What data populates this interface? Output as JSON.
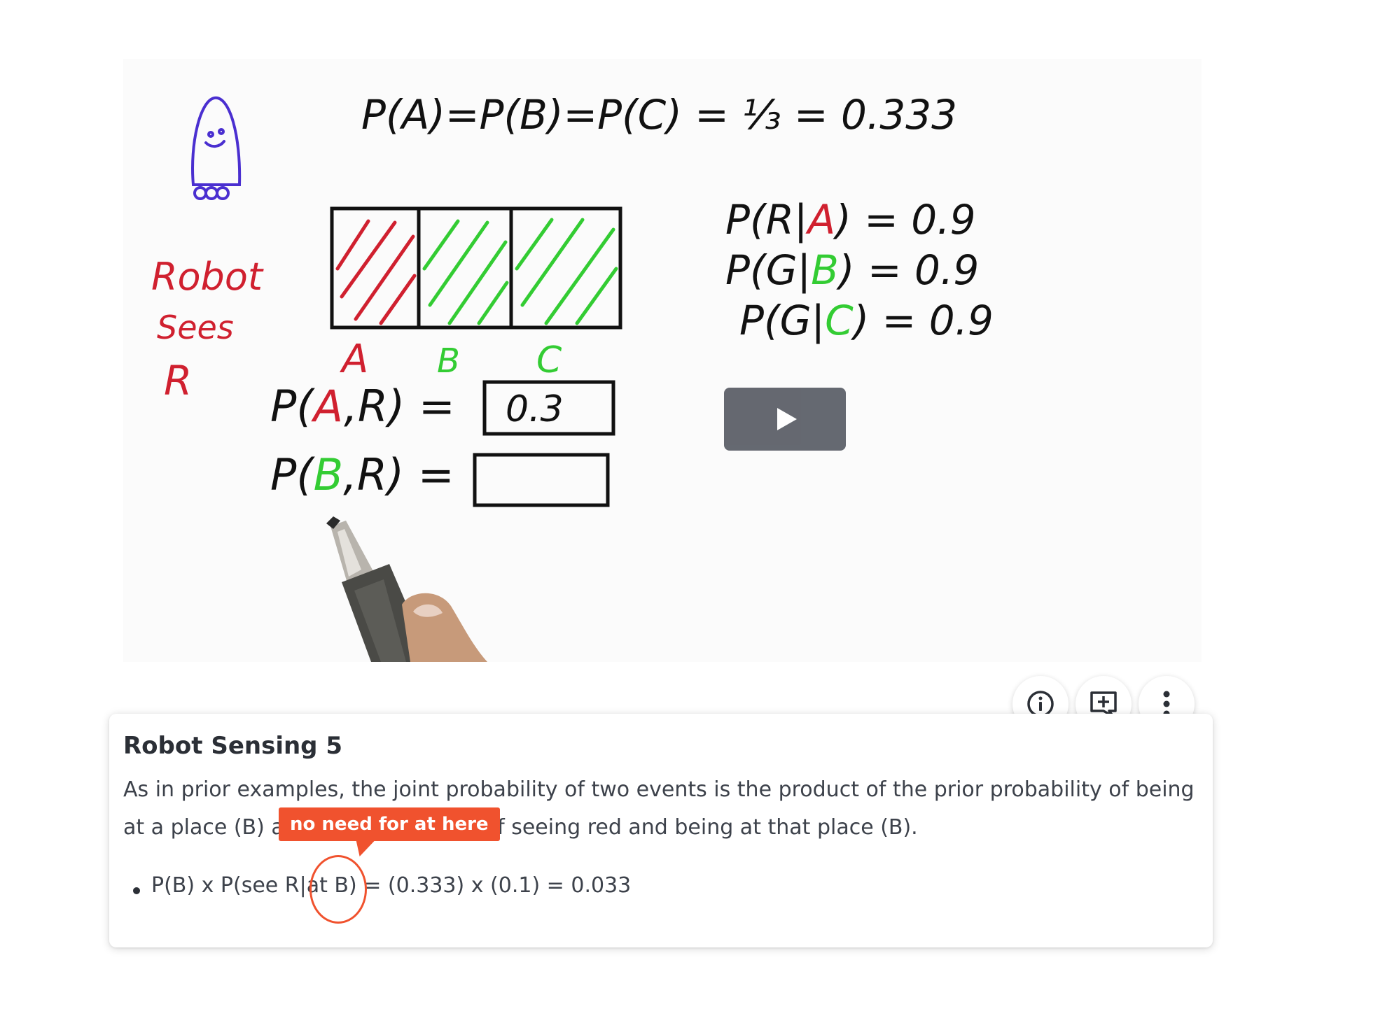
{
  "video": {
    "whiteboard": {
      "robot_label_lines": [
        "Robot",
        "Sees",
        "R"
      ],
      "prior_equation": "P(A)=P(B)=P(C) = ⅓ = 0.333",
      "cell_labels": [
        "A",
        "B",
        "C"
      ],
      "measurement_lines": [
        {
          "prefix": "P(R|",
          "var": "A",
          "suffix": ") = 0.9",
          "color": "#d0202f"
        },
        {
          "prefix": "P(G|",
          "var": "B",
          "suffix": ") = 0.9",
          "color": "#33cc33"
        },
        {
          "prefix": "P(G|",
          "var": "C",
          "suffix": ") = 0.9",
          "color": "#33cc33"
        }
      ],
      "joint_rows": [
        {
          "prefix": "P(",
          "var": "A",
          "suffix": ",R) =",
          "box_value": "0.3",
          "color": "#d0202f"
        },
        {
          "prefix": "P(",
          "var": "B",
          "suffix": ",R) =",
          "box_value": "",
          "color": "#33cc33"
        }
      ],
      "colors": {
        "red": "#d0202f",
        "green": "#33cc33",
        "ink": "#111111",
        "robot": "#4a2fd0"
      }
    },
    "play_icon": "play-icon"
  },
  "actions": {
    "info_icon": "info-icon",
    "add_note_icon": "add-note-icon",
    "more_icon": "more-vertical-icon"
  },
  "card": {
    "title": "Robot Sensing 5",
    "body_line1": "As in prior examples, the joint probability of two events is the product of the prior probability of being",
    "body_line2_start": "at a place (B) a",
    "body_line2_end": "of seeing red and being at that place (B).",
    "bullet": "P(B) x P(see R|at B) = (0.333) x (0.1) = 0.033"
  },
  "annotation": {
    "label": "no need for at here",
    "color": "#f0522e"
  }
}
